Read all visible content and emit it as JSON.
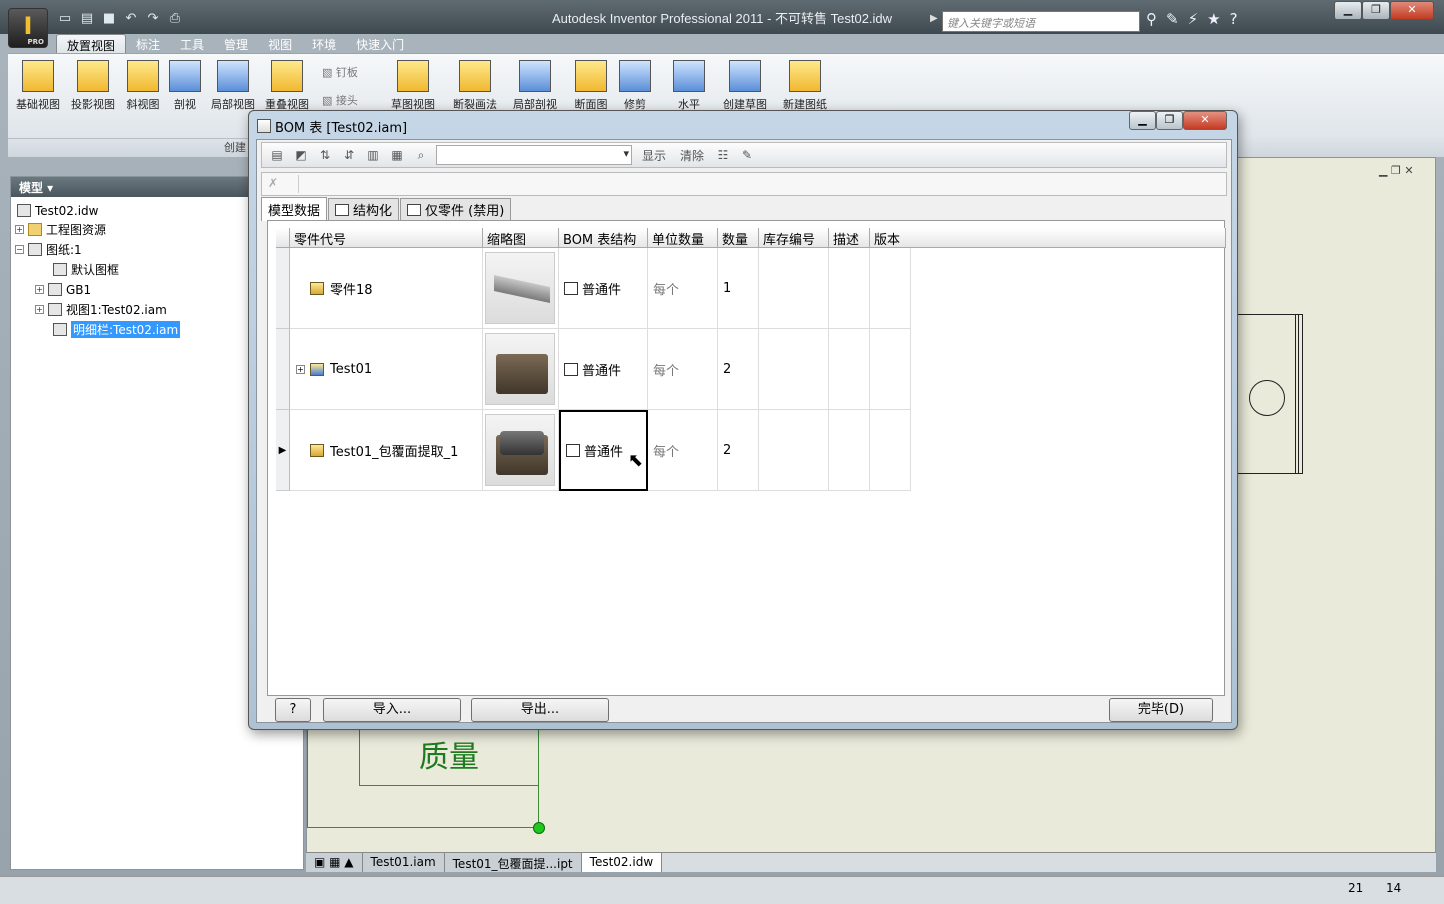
{
  "window": {
    "title": "Autodesk Inventor Professional 2011 - 不可转售      Test02.idw",
    "minimize": "▁",
    "restore": "❐",
    "close": "✕"
  },
  "app_button": {
    "glyph": "I",
    "badge": "PRO"
  },
  "quick_access": [
    "new-icon",
    "open-icon",
    "save-icon",
    "undo-icon",
    "redo-icon",
    "print-icon"
  ],
  "search": {
    "placeholder": "键入关键字或短语"
  },
  "ribbon_tabs": [
    "放置视图",
    "标注",
    "工具",
    "管理",
    "视图",
    "环境",
    "快速入门"
  ],
  "ribbon_buttons": [
    {
      "label": "基础视图"
    },
    {
      "label": "投影视图"
    },
    {
      "label": "斜视图"
    },
    {
      "label": "剖视"
    },
    {
      "label": "局部视图"
    },
    {
      "label": "重叠视图"
    },
    {
      "label": "草图视图"
    },
    {
      "label": "断裂画法"
    },
    {
      "label": "局部剖视图"
    },
    {
      "label": "断面图"
    },
    {
      "label": "修剪"
    },
    {
      "label": "水平"
    },
    {
      "label": "创建草图"
    },
    {
      "label": "新建图纸"
    }
  ],
  "ribbon_small": [
    "钉板",
    "接头"
  ],
  "ribbon_panel": "创建",
  "browser": {
    "title": "模型 ▾",
    "nodes": [
      "Test02.idw",
      "工程图资源",
      "图纸:1",
      "默认图框",
      "GB1",
      "视图1:Test02.iam",
      "明细栏:Test02.iam"
    ]
  },
  "canvas": {
    "table_text": "质量"
  },
  "doc_tabs": [
    "Test01.iam",
    "Test01_包覆面提...ipt",
    "Test02.idw"
  ],
  "status": {
    "x": "21",
    "y": "14"
  },
  "dialog": {
    "title": "BOM 表 [Test02.iam]",
    "toolbar_labels": {
      "show": "显示",
      "clear": "清除"
    },
    "tabs": [
      "模型数据",
      "结构化",
      "仅零件 (禁用)"
    ],
    "columns": [
      "零件代号",
      "缩略图",
      "BOM 表结构",
      "单位数量",
      "数量",
      "库存编号",
      "描述",
      "版本"
    ],
    "rows": [
      {
        "part": "零件18",
        "structure": "普通件",
        "unit": "每个",
        "qty": "1"
      },
      {
        "part": "Test01",
        "structure": "普通件",
        "unit": "每个",
        "qty": "2"
      },
      {
        "part": "Test01_包覆面提取_1",
        "structure": "普通件",
        "unit": "每个",
        "qty": "2"
      }
    ],
    "buttons": {
      "help": "?",
      "import": "导入...",
      "export": "导出...",
      "done": "完毕(D)"
    }
  }
}
